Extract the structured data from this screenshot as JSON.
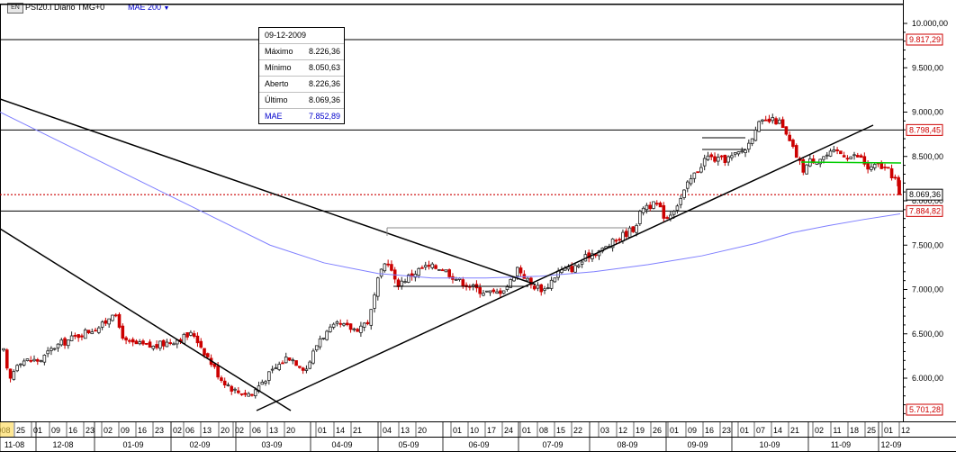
{
  "header": {
    "icon": "chart-icon",
    "symbol": "PSI20.I Diário TMG+0",
    "mae_label": "MAE 200",
    "dropdown_arrow": "▼"
  },
  "info_box": {
    "date": "09-12-2009",
    "rows": [
      {
        "key": "Máximo",
        "value": "8.226,36"
      },
      {
        "key": "Mínimo",
        "value": "8.050,63"
      },
      {
        "key": "Aberto",
        "value": "8.226,36"
      },
      {
        "key": "Último",
        "value": "8.069,36"
      }
    ],
    "mae": {
      "key": "MAE",
      "value": "7.852,89"
    }
  },
  "colors": {
    "up": "#222222",
    "down": "#cc0000",
    "mae": "#7f7fff",
    "trendline": "#000000",
    "support": "#00cc00",
    "last_dotted": "#cc0000",
    "price_label_red": "#cc0000",
    "price_label_black": "#000000"
  },
  "chart_data": {
    "type": "candlestick",
    "title": "PSI20.I Diário TMG+0",
    "y_ticks": [
      "10.000,00",
      "9.500,00",
      "9.000,00",
      "8.500,00",
      "8.000,00",
      "7.500,00",
      "7.000,00",
      "6.500,00",
      "6.000,00"
    ],
    "y_tick_values": [
      10000,
      9500,
      9000,
      8500,
      8000,
      7500,
      7000,
      6500,
      6000
    ],
    "ylim": [
      5650,
      10320
    ],
    "horizontal_levels": [
      {
        "value": 9817.29,
        "label": "9.817,29",
        "style": "red"
      },
      {
        "value": 8798.45,
        "label": "8.798,45",
        "style": "red"
      },
      {
        "value": 8069.36,
        "label": "8.069,36",
        "style": "black"
      },
      {
        "value": 7884.82,
        "label": "7.884,82",
        "style": "red"
      },
      {
        "value": 5701.28,
        "label": "5.701,28",
        "style": "red"
      }
    ],
    "day_labels": [
      "008",
      "25",
      "01",
      "09",
      "16",
      "23",
      "02",
      "09",
      "16",
      "23",
      "02",
      "06",
      "13",
      "20",
      "02",
      "06",
      "13",
      "20",
      "01",
      "14",
      "21",
      "04",
      "13",
      "20",
      "01",
      "10",
      "17",
      "24",
      "01",
      "08",
      "15",
      "22",
      "03",
      "12",
      "19",
      "26",
      "01",
      "09",
      "16",
      "23",
      "01",
      "07",
      "14",
      "21",
      "02",
      "11",
      "18",
      "25",
      "01",
      "12"
    ],
    "month_labels": [
      "11-08",
      "12-08",
      "01-09",
      "02-09",
      "03-09",
      "04-09",
      "05-09",
      "06-09",
      "07-09",
      "08-09",
      "09-09",
      "10-09",
      "11-09",
      "12-09"
    ],
    "date_range": [
      "2008-11",
      "2009-12-09"
    ],
    "last": {
      "date": "09-12-2009",
      "high": 8226.36,
      "low": 8050.63,
      "open": 8226.36,
      "close": 8069.36,
      "mae": 7852.89
    },
    "series": [
      {
        "name": "MAE 200",
        "type": "line"
      }
    ]
  }
}
